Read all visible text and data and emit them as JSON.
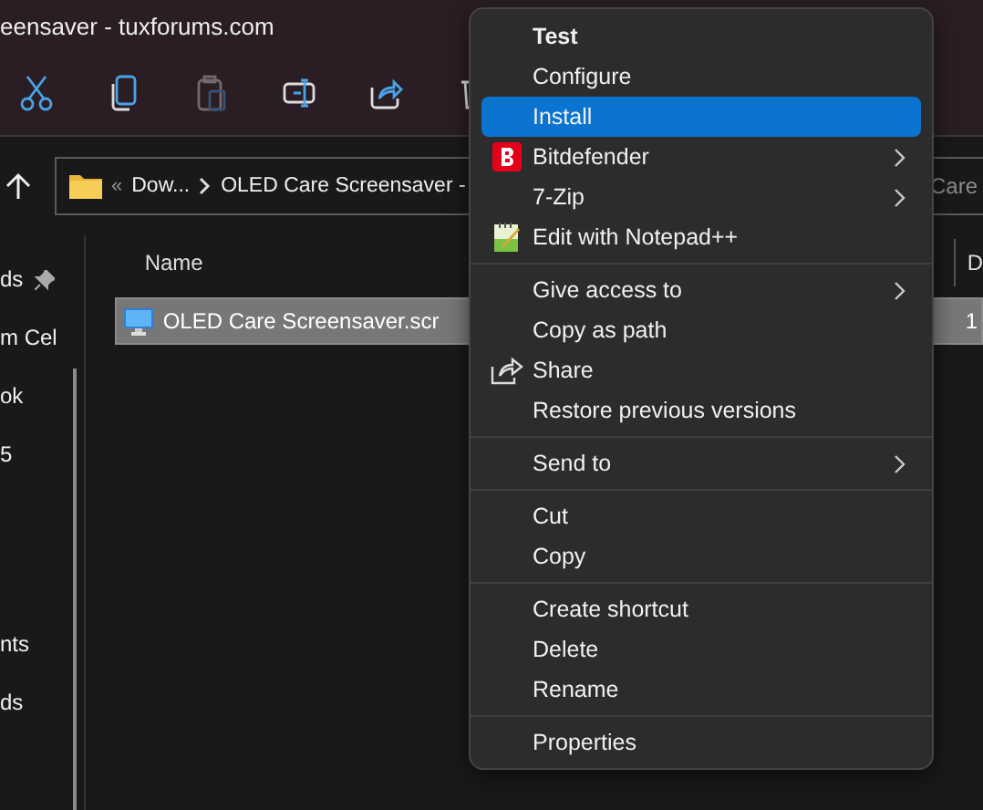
{
  "window": {
    "title": "eensaver - tuxforums.com"
  },
  "toolbar": {
    "buttons": [
      {
        "kind": "cut",
        "disabled": false
      },
      {
        "kind": "copy",
        "disabled": false
      },
      {
        "kind": "paste",
        "disabled": true
      },
      {
        "kind": "rename",
        "disabled": false
      },
      {
        "kind": "share",
        "disabled": false
      },
      {
        "kind": "delete",
        "disabled": false
      }
    ]
  },
  "address_bar": {
    "overflow_marker": "«",
    "segments": [
      "Dow...",
      "OLED Care Screensaver -"
    ]
  },
  "search": {
    "placeholder": "Care"
  },
  "nav_pane": {
    "items": [
      {
        "label": "ds",
        "pinned": true
      },
      {
        "label": "m Cel",
        "pinned": false
      },
      {
        "label": "ok",
        "pinned": false
      },
      {
        "label": "5",
        "pinned": false
      },
      {
        "label": "nts",
        "pinned": false
      },
      {
        "label": "ds",
        "pinned": false
      }
    ]
  },
  "file_list": {
    "columns": [
      "Name",
      "D"
    ],
    "rows": [
      {
        "name": "OLED Care Screensaver.scr",
        "column_2": "1",
        "selected": true
      }
    ]
  },
  "context_menu": {
    "groups": [
      [
        {
          "kind": "plain",
          "label": "Test",
          "bold": true,
          "selected": false,
          "submenu": false
        },
        {
          "kind": "plain",
          "label": "Configure",
          "bold": false,
          "selected": false,
          "submenu": false
        },
        {
          "kind": "plain",
          "label": "Install",
          "bold": false,
          "selected": true,
          "submenu": false
        },
        {
          "kind": "bitdefender",
          "label": "Bitdefender",
          "bold": false,
          "selected": false,
          "submenu": true
        },
        {
          "kind": "plain",
          "label": "7-Zip",
          "bold": false,
          "selected": false,
          "submenu": true
        },
        {
          "kind": "notepad",
          "label": "Edit with Notepad++",
          "bold": false,
          "selected": false,
          "submenu": false
        }
      ],
      [
        {
          "kind": "plain",
          "label": "Give access to",
          "bold": false,
          "selected": false,
          "submenu": true
        },
        {
          "kind": "plain",
          "label": "Copy as path",
          "bold": false,
          "selected": false,
          "submenu": false
        },
        {
          "kind": "share",
          "label": "Share",
          "bold": false,
          "selected": false,
          "submenu": false
        },
        {
          "kind": "plain",
          "label": "Restore previous versions",
          "bold": false,
          "selected": false,
          "submenu": false
        }
      ],
      [
        {
          "kind": "plain",
          "label": "Send to",
          "bold": false,
          "selected": false,
          "submenu": true
        }
      ],
      [
        {
          "kind": "plain",
          "label": "Cut",
          "bold": false,
          "selected": false,
          "submenu": false
        },
        {
          "kind": "plain",
          "label": "Copy",
          "bold": false,
          "selected": false,
          "submenu": false
        }
      ],
      [
        {
          "kind": "plain",
          "label": "Create shortcut",
          "bold": false,
          "selected": false,
          "submenu": false
        },
        {
          "kind": "plain",
          "label": "Delete",
          "bold": false,
          "selected": false,
          "submenu": false
        },
        {
          "kind": "plain",
          "label": "Rename",
          "bold": false,
          "selected": false,
          "submenu": false
        }
      ],
      [
        {
          "kind": "plain",
          "label": "Properties",
          "bold": false,
          "selected": false,
          "submenu": false
        }
      ]
    ]
  }
}
